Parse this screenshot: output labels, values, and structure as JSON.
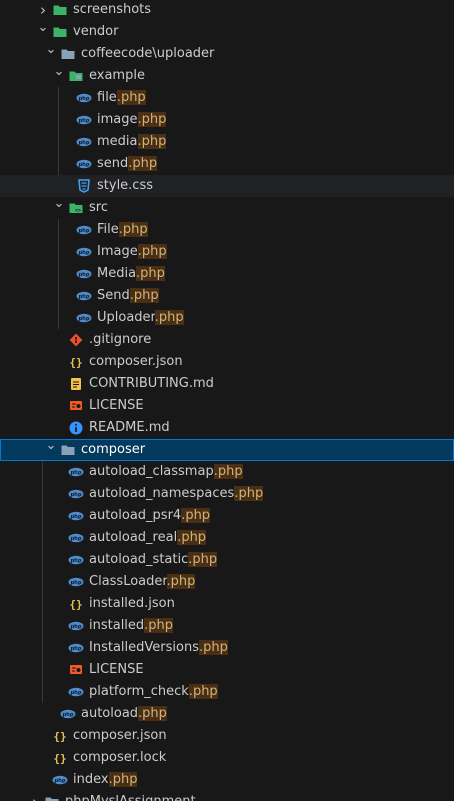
{
  "explorer": {
    "rows": [
      {
        "depth": 1,
        "kind": "folder",
        "open": false,
        "folderIcon": "screenshots-folder-icon",
        "name": "screenshots",
        "ext": ""
      },
      {
        "depth": 1,
        "kind": "folder",
        "open": true,
        "folderIcon": "vendor-folder-icon",
        "name": "vendor",
        "ext": ""
      },
      {
        "depth": 2,
        "kind": "folder",
        "open": true,
        "folderIcon": "folder-open-icon",
        "name": "coffeecode\\uploader",
        "ext": ""
      },
      {
        "depth": 3,
        "kind": "folder",
        "open": true,
        "folderIcon": "example-folder-icon",
        "name": "example",
        "ext": ""
      },
      {
        "depth": 4,
        "kind": "file",
        "icon": "php",
        "name": "file",
        "ext": ".php"
      },
      {
        "depth": 4,
        "kind": "file",
        "icon": "php",
        "name": "image",
        "ext": ".php"
      },
      {
        "depth": 4,
        "kind": "file",
        "icon": "php",
        "name": "media",
        "ext": ".php"
      },
      {
        "depth": 4,
        "kind": "file",
        "icon": "php",
        "name": "send",
        "ext": ".php"
      },
      {
        "depth": 4,
        "kind": "file",
        "icon": "css",
        "name": "style.css",
        "ext": "",
        "hover": true
      },
      {
        "depth": 3,
        "kind": "folder",
        "open": true,
        "folderIcon": "src-folder-icon",
        "name": "src",
        "ext": ""
      },
      {
        "depth": 4,
        "kind": "file",
        "icon": "php",
        "name": "File",
        "ext": ".php"
      },
      {
        "depth": 4,
        "kind": "file",
        "icon": "php",
        "name": "Image",
        "ext": ".php"
      },
      {
        "depth": 4,
        "kind": "file",
        "icon": "php",
        "name": "Media",
        "ext": ".php"
      },
      {
        "depth": 4,
        "kind": "file",
        "icon": "php",
        "name": "Send",
        "ext": ".php"
      },
      {
        "depth": 4,
        "kind": "file",
        "icon": "php",
        "name": "Uploader",
        "ext": ".php"
      },
      {
        "depth": 3,
        "kind": "file",
        "icon": "git",
        "name": ".gitignore",
        "ext": ""
      },
      {
        "depth": 3,
        "kind": "file",
        "icon": "json",
        "name": "composer.json",
        "ext": ""
      },
      {
        "depth": 3,
        "kind": "file",
        "icon": "contrib",
        "name": "CONTRIBUTING.md",
        "ext": ""
      },
      {
        "depth": 3,
        "kind": "file",
        "icon": "license",
        "name": "LICENSE",
        "ext": ""
      },
      {
        "depth": 3,
        "kind": "file",
        "icon": "info",
        "name": "README.md",
        "ext": ""
      },
      {
        "depth": 2,
        "kind": "folder",
        "open": true,
        "folderIcon": "folder-open-icon",
        "name": "composer",
        "ext": "",
        "selected": true
      },
      {
        "depth": 3,
        "kind": "file",
        "icon": "php",
        "name": "autoload_classmap",
        "ext": ".php"
      },
      {
        "depth": 3,
        "kind": "file",
        "icon": "php",
        "name": "autoload_namespaces",
        "ext": ".php"
      },
      {
        "depth": 3,
        "kind": "file",
        "icon": "php",
        "name": "autoload_psr4",
        "ext": ".php"
      },
      {
        "depth": 3,
        "kind": "file",
        "icon": "php",
        "name": "autoload_real",
        "ext": ".php"
      },
      {
        "depth": 3,
        "kind": "file",
        "icon": "php",
        "name": "autoload_static",
        "ext": ".php"
      },
      {
        "depth": 3,
        "kind": "file",
        "icon": "php",
        "name": "ClassLoader",
        "ext": ".php"
      },
      {
        "depth": 3,
        "kind": "file",
        "icon": "json",
        "name": "installed.json",
        "ext": ""
      },
      {
        "depth": 3,
        "kind": "file",
        "icon": "php",
        "name": "installed",
        "ext": ".php"
      },
      {
        "depth": 3,
        "kind": "file",
        "icon": "php",
        "name": "InstalledVersions",
        "ext": ".php"
      },
      {
        "depth": 3,
        "kind": "file",
        "icon": "license",
        "name": "LICENSE",
        "ext": ""
      },
      {
        "depth": 3,
        "kind": "file",
        "icon": "php",
        "name": "platform_check",
        "ext": ".php"
      },
      {
        "depth": 2,
        "kind": "file",
        "icon": "php",
        "name": "autoload",
        "ext": ".php"
      },
      {
        "depth": 1,
        "kind": "file",
        "icon": "json",
        "name": "composer.json",
        "ext": ""
      },
      {
        "depth": 1,
        "kind": "file",
        "icon": "json",
        "name": "composer.lock",
        "ext": ""
      },
      {
        "depth": 1,
        "kind": "file",
        "icon": "php",
        "name": "index",
        "ext": ".php"
      },
      {
        "depth": 0,
        "kind": "folder",
        "open": false,
        "folderIcon": "folder-icon",
        "name": "phpMyslAssignment",
        "ext": ""
      }
    ]
  },
  "colors": {
    "background": "#181818",
    "selected_bg": "#04395e",
    "selected_border": "#0078d4",
    "php": "#4f8cc9",
    "json": "#e8c254",
    "css": "#42a5f5",
    "git": "#f0502f",
    "license": "#f15a24",
    "info": "#3794ff",
    "contrib": "#f2c14e",
    "folder": "#8aa2b5",
    "folder_green": "#3db36a",
    "ext_highlight": "#4b2f14"
  }
}
